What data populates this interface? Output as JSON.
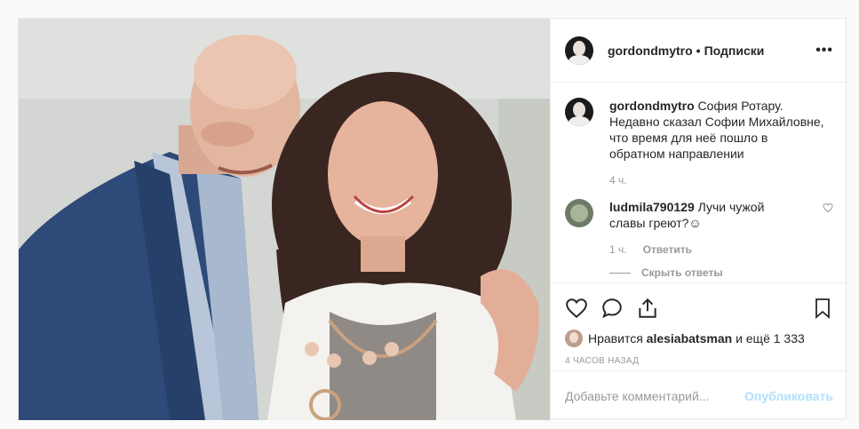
{
  "post": {
    "username": "gordondmytro",
    "separator": "•",
    "follow_label": "Подписки",
    "more_icon": "more-dots-icon",
    "caption": {
      "username": "gordondmytro",
      "text_line1": "София Ротару.",
      "text_line2": "Недавно сказал Софии Михайловне,",
      "text_line3": "что время для неё пошло в",
      "text_line4": "обратном направлении",
      "time": "4 ч."
    },
    "comment": {
      "username": "ludmila790129",
      "text_line1": "Лучи чужой",
      "text_line2": "славы греют?☺",
      "time": "1 ч.",
      "reply_label": "Ответить",
      "hide_replies_label": "Скрыть ответы"
    },
    "likes": {
      "prefix": "Нравится",
      "user": "alesiabatsman",
      "suffix": "и ещё 1 333"
    },
    "timestamp": "4 ЧАСОВ НАЗАД",
    "add_comment": {
      "placeholder": "Добавьте комментарий...",
      "publish_label": "Опубликовать"
    },
    "colors": {
      "text": "#262626",
      "muted": "#999999",
      "publish_disabled": "#b2dffc",
      "border": "#efefef"
    }
  }
}
